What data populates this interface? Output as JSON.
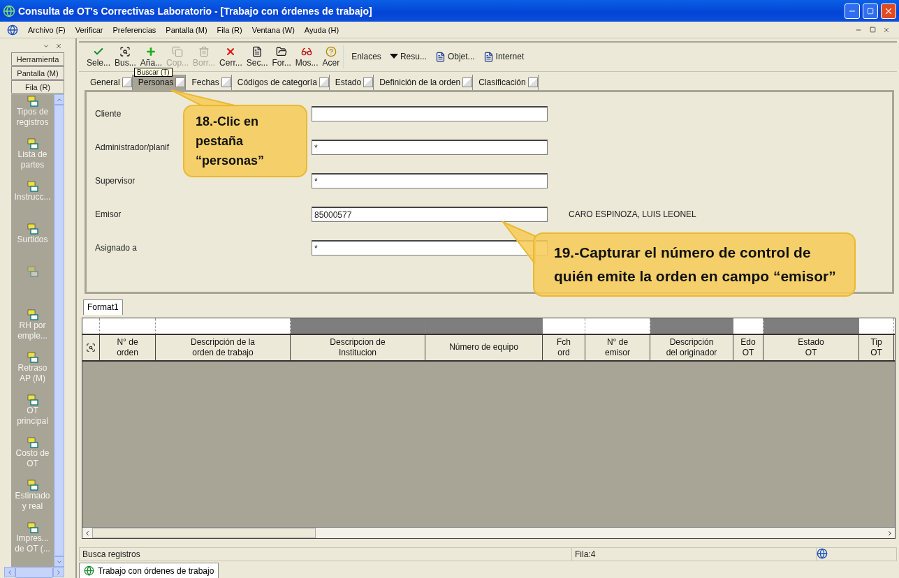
{
  "window": {
    "title": "Consulta de OT's Correctivas Laboratorio - [Trabajo con órdenes de trabajo]"
  },
  "menu": [
    "Archivo (F)",
    "Verificar",
    "Preferencias",
    "Pantalla (M)",
    "Fila (R)",
    "Ventana (W)",
    "Ayuda (H)"
  ],
  "side_panel": {
    "buttons": [
      "Herramienta",
      "Pantalla (M)",
      "Fila (R)"
    ],
    "items": [
      {
        "kind": "item",
        "label": "Tipos de registros"
      },
      {
        "kind": "item",
        "label": "Lista de partes"
      },
      {
        "kind": "item",
        "label": "Instrucc..."
      },
      {
        "kind": "item",
        "label": "Surtidos"
      },
      {
        "kind": "blank"
      },
      {
        "kind": "item",
        "label": "RH por emple..."
      },
      {
        "kind": "item",
        "label": "Retraso AP (M)"
      },
      {
        "kind": "item",
        "label": "OT principal"
      },
      {
        "kind": "item",
        "label": "Costo de OT"
      },
      {
        "kind": "item",
        "label": "Estimado y real"
      },
      {
        "kind": "item",
        "label": "Impres... de OT (..."
      }
    ]
  },
  "toolbar": [
    {
      "label": "Sele...",
      "kind": "check",
      "disabled": false
    },
    {
      "label": "Bus...",
      "kind": "search",
      "disabled": false
    },
    {
      "label": "Aña...",
      "kind": "add",
      "disabled": false
    },
    {
      "label": "Cop...",
      "kind": "copy",
      "disabled": true
    },
    {
      "label": "Borr...",
      "kind": "delete",
      "disabled": true
    },
    {
      "label": "Cerr...",
      "kind": "close",
      "disabled": false
    },
    {
      "label": "Sec...",
      "kind": "doc",
      "disabled": false
    },
    {
      "label": "For...",
      "kind": "folder",
      "disabled": false
    },
    {
      "label": "Mos...",
      "kind": "glasses",
      "disabled": false
    },
    {
      "label": "Acer",
      "kind": "help",
      "disabled": false
    }
  ],
  "links": [
    {
      "label": "Enlaces",
      "kind": "text"
    },
    {
      "label": "Resu...",
      "kind": "dropdown"
    },
    {
      "label": "Objet...",
      "kind": "doc"
    },
    {
      "label": "Internet",
      "kind": "doc"
    }
  ],
  "tooltip": {
    "text": "Buscar (T)"
  },
  "tabs": [
    {
      "label": "General",
      "selected": false
    },
    {
      "label": "Personas",
      "selected": true
    },
    {
      "label": "Fechas",
      "selected": false
    },
    {
      "label": "Códigos de categoría",
      "selected": false
    },
    {
      "label": "Estado",
      "selected": false
    },
    {
      "label": "Definición de la orden",
      "selected": false
    },
    {
      "label": "Clasificación",
      "selected": false
    }
  ],
  "form": [
    {
      "label": "Cliente"
    },
    {
      "label": "Administrador/planif",
      "value": "*"
    },
    {
      "label": "Supervisor",
      "value": "*"
    },
    {
      "label": "Emisor",
      "value": "85000577",
      "description": "CARO ESPINOZA, LUIS LEONEL"
    },
    {
      "label": "Asignado a",
      "value": "*"
    }
  ],
  "grid": {
    "subtab": "Format1",
    "columns": [
      {
        "kind": "icon",
        "shaded": false
      },
      {
        "kind": "text",
        "label": "N° de\norden",
        "shaded": false
      },
      {
        "kind": "text",
        "label": "Descripción de la\norden de trabajo",
        "shaded": false
      },
      {
        "kind": "text",
        "label": "Descripcion de\nInstitucion",
        "shaded": true
      },
      {
        "kind": "text",
        "label": "Número de equipo",
        "shaded": true
      },
      {
        "kind": "text",
        "label": "Fch\nord",
        "shaded": false
      },
      {
        "kind": "text",
        "label": "N° de\nemisor",
        "shaded": false
      },
      {
        "kind": "text",
        "label": "Descripción\ndel originador",
        "shaded": true
      },
      {
        "kind": "text",
        "label": "Edo\nOT",
        "shaded": false
      },
      {
        "kind": "text",
        "label": "Estado\nOT",
        "shaded": true
      },
      {
        "kind": "text",
        "label": "Tip\nOT",
        "shaded": false
      }
    ]
  },
  "status_bar": [
    "Busca registros",
    "Fila:4"
  ],
  "task_tab": "Trabajo con órdenes de trabajo",
  "callouts": [
    "18.-Clic en pestaña “personas”",
    "19.-Capturar el número de control de quién emite la orden en campo “emisor”"
  ]
}
